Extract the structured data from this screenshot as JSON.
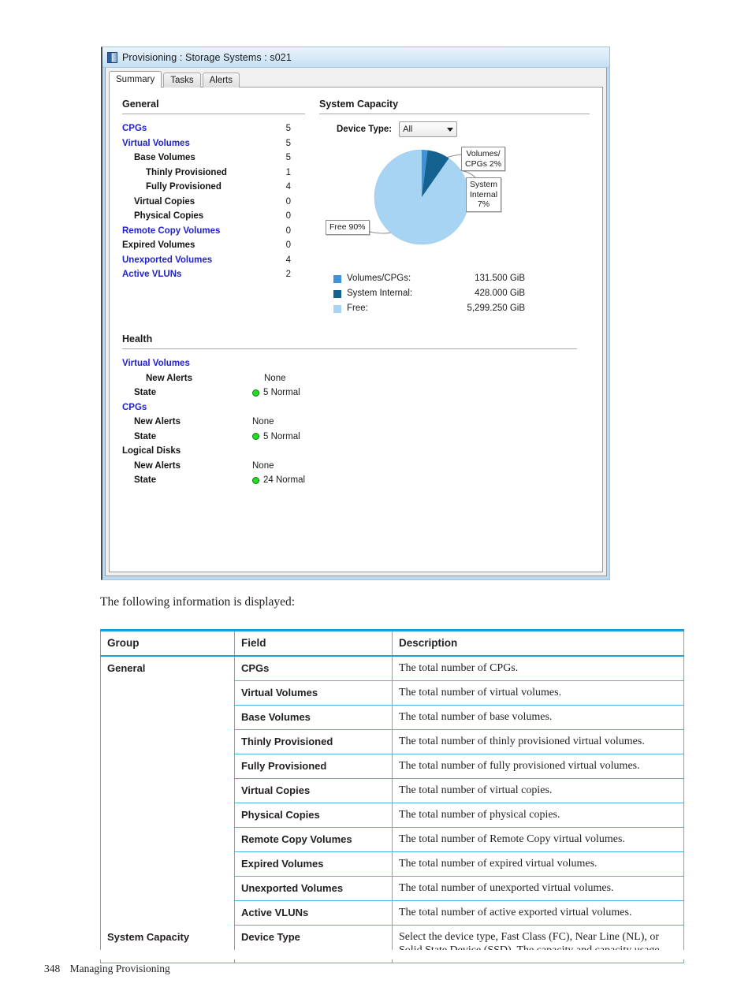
{
  "window": {
    "title": "Provisioning : Storage Systems : s021",
    "icon": "storage-system-icon",
    "tabs": [
      {
        "label": "Summary",
        "active": true
      },
      {
        "label": "Tasks",
        "active": false
      },
      {
        "label": "Alerts",
        "active": false
      }
    ]
  },
  "general": {
    "heading": "General",
    "rows": [
      {
        "label": "CPGs",
        "value": "5",
        "indent": 0,
        "link": true
      },
      {
        "label": "Virtual Volumes",
        "value": "5",
        "indent": 0,
        "link": true
      },
      {
        "label": "Base Volumes",
        "value": "5",
        "indent": 1,
        "link": false
      },
      {
        "label": "Thinly Provisioned",
        "value": "1",
        "indent": 2,
        "link": false
      },
      {
        "label": "Fully Provisioned",
        "value": "4",
        "indent": 2,
        "link": false
      },
      {
        "label": "Virtual Copies",
        "value": "0",
        "indent": 1,
        "link": false
      },
      {
        "label": "Physical Copies",
        "value": "0",
        "indent": 1,
        "link": false
      },
      {
        "label": "Remote Copy Volumes",
        "value": "0",
        "indent": 0,
        "link": true
      },
      {
        "label": "Expired Volumes",
        "value": "0",
        "indent": 0,
        "link": false
      },
      {
        "label": "Unexported Volumes",
        "value": "4",
        "indent": 0,
        "link": true
      },
      {
        "label": "Active VLUNs",
        "value": "2",
        "indent": 0,
        "link": true
      }
    ]
  },
  "system_capacity": {
    "heading": "System Capacity",
    "device_type_label": "Device Type:",
    "device_type_value": "All"
  },
  "chart_data": {
    "type": "pie",
    "title": "System Capacity",
    "categories": [
      "Volumes/CPGs",
      "System Internal",
      "Free"
    ],
    "values": [
      131.5,
      428.0,
      5299.25
    ],
    "value_labels": [
      "131.500 GiB",
      "428.000 GiB",
      "5,299.250 GiB"
    ],
    "percents": [
      2,
      7,
      90
    ],
    "callouts": [
      "Volumes/\nCPGs 2%",
      "System\nInternal\n7%",
      "Free 90%"
    ],
    "colors": [
      "#3e93da",
      "#14628f",
      "#a7d4f2"
    ],
    "legend_position": "bottom",
    "units": "GiB"
  },
  "health": {
    "heading": "Health",
    "groups": [
      {
        "name": "Virtual Volumes",
        "link": true,
        "rows": [
          {
            "label": "New Alerts",
            "value": "None",
            "dot": false
          },
          {
            "label": "State",
            "value": "5 Normal",
            "dot": true
          }
        ]
      },
      {
        "name": "CPGs",
        "link": true,
        "rows": [
          {
            "label": "New Alerts",
            "value": "None",
            "dot": false
          },
          {
            "label": "State",
            "value": "5 Normal",
            "dot": true
          }
        ]
      },
      {
        "name": "Logical Disks",
        "link": false,
        "rows": [
          {
            "label": "New Alerts",
            "value": "None",
            "dot": false
          },
          {
            "label": "State",
            "value": "24 Normal",
            "dot": true
          }
        ]
      }
    ],
    "status_color": "#22dd22"
  },
  "body": {
    "intro": "The following information is displayed:"
  },
  "table": {
    "headers": [
      "Group",
      "Field",
      "Description"
    ],
    "groups": [
      {
        "group": "General",
        "rows": [
          {
            "field": "CPGs",
            "description": "The total number of CPGs."
          },
          {
            "field": "Virtual Volumes",
            "description": "The total number of virtual volumes."
          },
          {
            "field": "Base Volumes",
            "description": "The total number of base volumes."
          },
          {
            "field": "Thinly Provisioned",
            "description": "The total number of thinly provisioned virtual volumes."
          },
          {
            "field": "Fully Provisioned",
            "description": "The total number of fully provisioned virtual volumes."
          },
          {
            "field": "Virtual Copies",
            "description": "The total number of virtual copies."
          },
          {
            "field": "Physical Copies",
            "description": "The total number of physical copies."
          },
          {
            "field": "Remote Copy Volumes",
            "description": "The total number of Remote Copy virtual volumes."
          },
          {
            "field": "Expired Volumes",
            "description": "The total number of expired virtual volumes."
          },
          {
            "field": "Unexported Volumes",
            "description": "The total number of unexported virtual volumes."
          },
          {
            "field": "Active VLUNs",
            "description": "The total number of active exported virtual volumes."
          }
        ]
      },
      {
        "group": "System Capacity",
        "rows": [
          {
            "field": "Device Type",
            "description": "Select the device type, Fast Class (FC), Near Line (NL), or Solid State Device (SSD). The capacity and capacity usage"
          }
        ]
      }
    ]
  },
  "footer": {
    "page_number": "348",
    "chapter": "Managing Provisioning"
  }
}
